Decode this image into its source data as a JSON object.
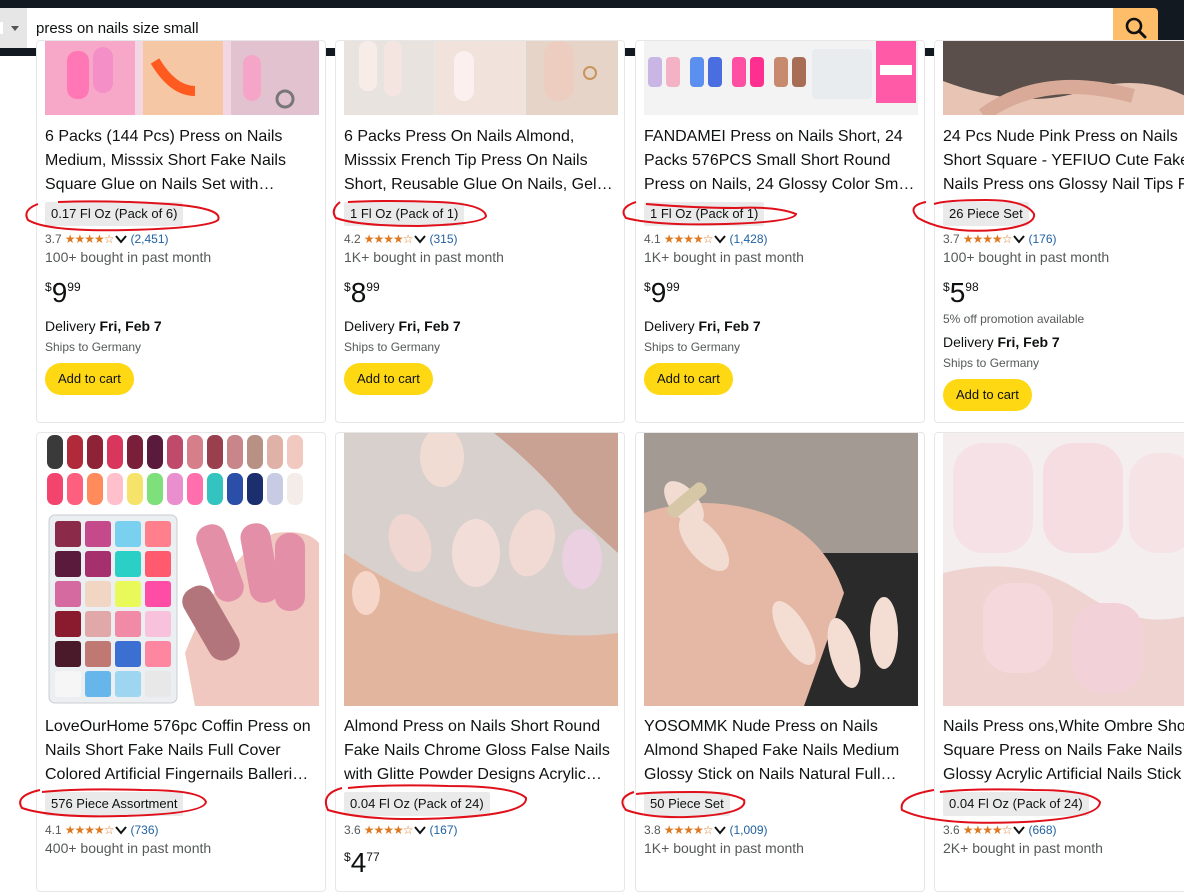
{
  "search": {
    "query": "press on nails size small"
  },
  "cards_row1": [
    {
      "title": [
        "6 Packs (144 Pcs) Press on Nails",
        "Medium, Misssix Short Fake Nails",
        "Square Glue on Nails Set with…"
      ],
      "badge": "0.17 Fl Oz (Pack of 6)",
      "rating": "3.7",
      "count": "(2,451)",
      "bought": "100+ bought in past month",
      "price_symbol": "$",
      "price_whole": "9",
      "price_fraction": "99",
      "promo": "",
      "delivery_prefix": "Delivery ",
      "delivery_date": "Fri, Feb 7",
      "ships": "Ships to Germany",
      "cart": "Add to cart"
    },
    {
      "title": [
        "6 Packs Press On Nails Almond,",
        "Misssix French Tip Press On Nails",
        "Short, Reusable Glue On Nails, Gel…"
      ],
      "badge": "1 Fl Oz (Pack of 1)",
      "rating": "4.2",
      "count": "(315)",
      "bought": "1K+ bought in past month",
      "price_symbol": "$",
      "price_whole": "8",
      "price_fraction": "99",
      "promo": "",
      "delivery_prefix": "Delivery ",
      "delivery_date": "Fri, Feb 7",
      "ships": "Ships to Germany",
      "cart": "Add to cart"
    },
    {
      "title": [
        "FANDAMEI Press on Nails Short, 24",
        "Packs 576PCS Small Short Round",
        "Press on Nails, 24 Glossy Color Sma…"
      ],
      "badge": "1 Fl Oz (Pack of 1)",
      "rating": "4.1",
      "count": "(1,428)",
      "bought": "1K+ bought in past month",
      "price_symbol": "$",
      "price_whole": "9",
      "price_fraction": "99",
      "promo": "",
      "delivery_prefix": "Delivery ",
      "delivery_date": "Fri, Feb 7",
      "ships": "Ships to Germany",
      "cart": "Add to cart"
    },
    {
      "title": [
        "24 Pcs Nude Pink Press on Nails",
        "Short Square - YEFIUO Cute Fake",
        "Nails Press ons Glossy Nail Tips Fu"
      ],
      "badge": "26 Piece Set",
      "rating": "3.7",
      "count": "(176)",
      "bought": "100+ bought in past month",
      "price_symbol": "$",
      "price_whole": "5",
      "price_fraction": "98",
      "promo": "5% off promotion available",
      "delivery_prefix": "Delivery ",
      "delivery_date": "Fri, Feb 7",
      "ships": "Ships to Germany",
      "cart": "Add to cart"
    }
  ],
  "cards_row2": [
    {
      "title": [
        "LoveOurHome 576pc Coffin Press on",
        "Nails Short Fake Nails Full Cover",
        "Colored Artificial Fingernails Balleri…"
      ],
      "badge": "576 Piece Assortment",
      "rating": "4.1",
      "count": "(736)",
      "bought": "400+ bought in past month"
    },
    {
      "title": [
        "Almond Press on Nails Short Round",
        "Fake Nails Chrome Gloss False Nails",
        "with Glitte Powder Designs Acrylic…"
      ],
      "badge": "0.04 Fl Oz (Pack of 24)",
      "rating": "3.6",
      "count": "(167)",
      "bought": "",
      "price_symbol": "$",
      "price_whole": "4",
      "price_fraction": "77"
    },
    {
      "title": [
        "YOSOMMK Nude Press on Nails",
        "Almond Shaped Fake Nails Medium",
        "Glossy Stick on Nails Natural Full…"
      ],
      "badge": "50 Piece Set",
      "rating": "3.8",
      "count": "(1,009)",
      "bought": "1K+ bought in past month"
    },
    {
      "title": [
        "Nails Press ons,White Ombre Sho",
        "Square Press on Nails Fake Nails",
        "Glossy Acrylic Artificial Nails Stick"
      ],
      "badge": "0.04 Fl Oz (Pack of 24)",
      "rating": "3.6",
      "count": "(668)",
      "bought": "2K+ bought in past month"
    }
  ],
  "colors": {
    "accent_yellow": "#ffd814",
    "search_button": "#febd69",
    "star": "#de7921",
    "link": "#2162a1",
    "annotation_red": "#e0101a"
  }
}
